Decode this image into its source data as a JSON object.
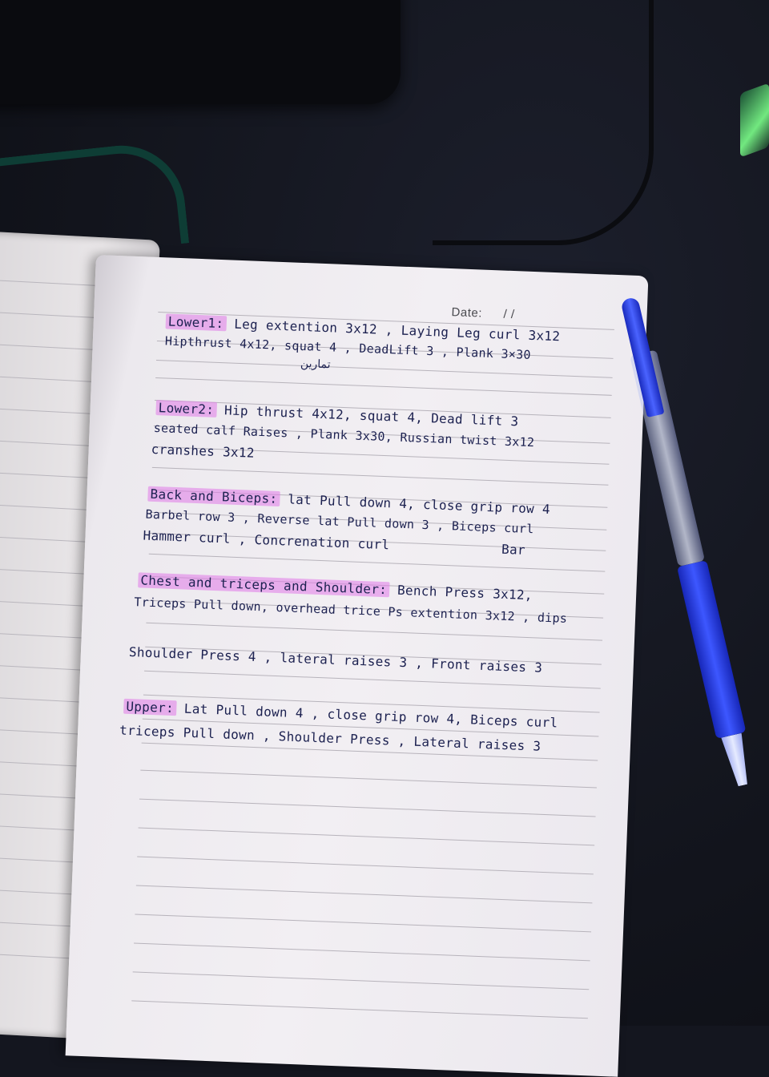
{
  "notebook": {
    "date_label": "Date:",
    "date_value": "/ /",
    "sections": [
      {
        "heading": "Lower1:",
        "lines": [
          "Leg extention 3x12 , Laying Leg curl 3x12",
          "Hipthrust 4x12, squat 4 , DeadLift 3 , Plank 3×30",
          "تمارين"
        ]
      },
      {
        "heading": "Lower2:",
        "lines": [
          "Hip thrust 4x12, squat 4, Dead lift 3",
          "seated calf Raises , Plank 3x30, Russian twist 3x12",
          "cranshes 3x12"
        ]
      },
      {
        "heading": "Back and Biceps:",
        "lines": [
          "lat Pull down 4, close grip row 4",
          "Barbel row 3 , Reverse lat Pull down 3 , Biceps curl",
          "Hammer curl , Concrenation curl",
          "Bar"
        ]
      },
      {
        "heading": "Chest and triceps and Shoulder:",
        "lines": [
          "Bench Press 3x12,",
          "Triceps Pull down, overhead trice Ps extention 3x12 , dips",
          "Shoulder Press 4 , lateral raises 3 , Front raises 3"
        ]
      },
      {
        "heading": "Upper:",
        "lines": [
          "Lat Pull down 4 , close grip row 4, Biceps curl",
          "triceps Pull down , Shoulder Press , Lateral raises 3"
        ]
      }
    ]
  },
  "colors": {
    "ink": "#1c2150",
    "highlighter": "#e078e8",
    "pen": "#2f45f0",
    "paper": "#f2eff3"
  }
}
